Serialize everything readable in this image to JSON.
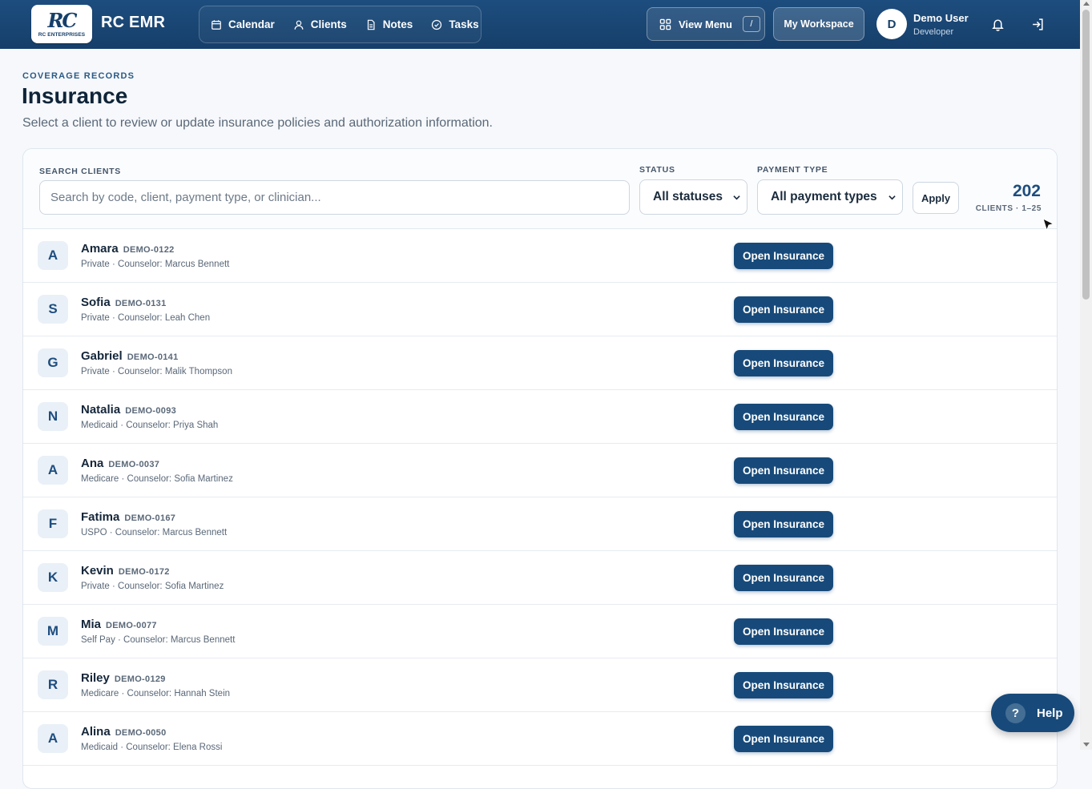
{
  "app": {
    "logo_mark": "RC",
    "logo_sub": "RC ENTERPRISES",
    "title": "RC EMR"
  },
  "nav": [
    {
      "label": "Calendar",
      "icon": "calendar-icon"
    },
    {
      "label": "Clients",
      "icon": "user-icon"
    },
    {
      "label": "Notes",
      "icon": "document-icon"
    },
    {
      "label": "Tasks",
      "icon": "check-circle-icon"
    }
  ],
  "header": {
    "view_menu_label": "View Menu",
    "view_menu_shortcut": "/",
    "workspace_label": "My Workspace",
    "user_initial": "D",
    "user_name": "Demo User",
    "user_role": "Developer"
  },
  "page": {
    "eyebrow": "COVERAGE RECORDS",
    "title": "Insurance",
    "subtitle": "Select a client to review or update insurance policies and authorization information."
  },
  "filters": {
    "search_label": "SEARCH CLIENTS",
    "search_placeholder": "Search by code, client, payment type, or clinician...",
    "status_label": "STATUS",
    "status_value": "All statuses",
    "payment_label": "PAYMENT TYPE",
    "payment_value": "All payment types",
    "apply_label": "Apply",
    "count": "202",
    "count_label": "CLIENTS · 1–25"
  },
  "row_button_label": "Open Insurance",
  "clients": [
    {
      "initial": "A",
      "name": "Amara",
      "code": "DEMO-0122",
      "meta": "Private · Counselor: Marcus Bennett"
    },
    {
      "initial": "S",
      "name": "Sofia",
      "code": "DEMO-0131",
      "meta": "Private · Counselor: Leah Chen"
    },
    {
      "initial": "G",
      "name": "Gabriel",
      "code": "DEMO-0141",
      "meta": "Private · Counselor: Malik Thompson"
    },
    {
      "initial": "N",
      "name": "Natalia",
      "code": "DEMO-0093",
      "meta": "Medicaid · Counselor: Priya Shah"
    },
    {
      "initial": "A",
      "name": "Ana",
      "code": "DEMO-0037",
      "meta": "Medicare · Counselor: Sofia Martinez"
    },
    {
      "initial": "F",
      "name": "Fatima",
      "code": "DEMO-0167",
      "meta": "USPO · Counselor: Marcus Bennett"
    },
    {
      "initial": "K",
      "name": "Kevin",
      "code": "DEMO-0172",
      "meta": "Private · Counselor: Sofia Martinez"
    },
    {
      "initial": "M",
      "name": "Mia",
      "code": "DEMO-0077",
      "meta": "Self Pay · Counselor: Marcus Bennett"
    },
    {
      "initial": "R",
      "name": "Riley",
      "code": "DEMO-0129",
      "meta": "Medicare · Counselor: Hannah Stein"
    },
    {
      "initial": "A",
      "name": "Alina",
      "code": "DEMO-0050",
      "meta": "Medicaid · Counselor: Elena Rossi"
    }
  ],
  "help_label": "Help",
  "help_glyph": "?",
  "colors": {
    "brand": "#174a7a",
    "header_bg": "#1d4d7e",
    "accent_text": "#1d4d7e"
  }
}
